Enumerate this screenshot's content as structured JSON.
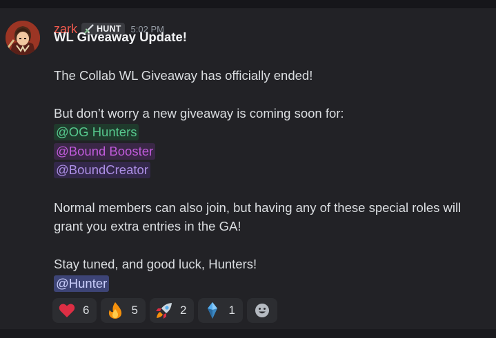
{
  "author": {
    "username": "zark",
    "tag": "HUNT",
    "timestamp": "5:02 PM"
  },
  "message": {
    "title": "WL Giveaway Update!",
    "line_ended": "The Collab WL Giveaway has officially ended!",
    "line_coming": "But don’t worry  a new giveaway is coming soon for:",
    "mentions": [
      "@OG Hunters",
      "@Bound Booster",
      "@BoundCreator"
    ],
    "line_normal_1": "Normal members can also join, but having any of these special roles will",
    "line_normal_2": "grant you extra entries in the GA!",
    "line_stay": "Stay tuned, and good luck, Hunters!",
    "final_mention": "@Hunter"
  },
  "reactions": [
    {
      "icon": "heart-emoji",
      "count": "6"
    },
    {
      "icon": "fire-emoji",
      "count": "5"
    },
    {
      "icon": "rocket-emoji",
      "count": "2"
    },
    {
      "icon": "crystal-emoji",
      "count": "1"
    }
  ],
  "colors": {
    "username": "#f05a4e",
    "og_hunters": "#57c98e",
    "bound_booster": "#c05bdb",
    "bound_creator": "#ad8fe6",
    "hunter": "#c9cdfb"
  }
}
